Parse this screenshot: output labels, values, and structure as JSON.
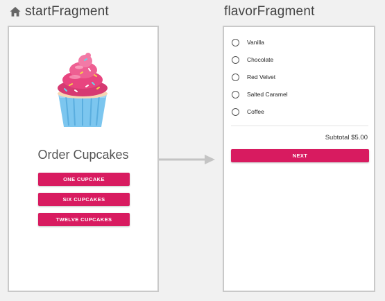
{
  "start_fragment": {
    "title": "startFragment",
    "heading": "Order Cupcakes",
    "buttons": [
      "ONE CUPCAKE",
      "SIX CUPCAKES",
      "TWELVE CUPCAKES"
    ]
  },
  "flavor_fragment": {
    "title": "flavorFragment",
    "flavors": [
      "Vanilla",
      "Chocolate",
      "Red Velvet",
      "Salted Caramel",
      "Coffee"
    ],
    "subtotal": "Subtotal $5.00",
    "next_label": "NEXT"
  },
  "colors": {
    "accent": "#d81b60",
    "frosting": "#e8447f",
    "wrapper": "#7cc6ef",
    "background": "#f1f1f1",
    "arrow": "#c4c4c4"
  },
  "icons": [
    "home-icon",
    "navigation-arrow-icon",
    "cupcake-image"
  ]
}
